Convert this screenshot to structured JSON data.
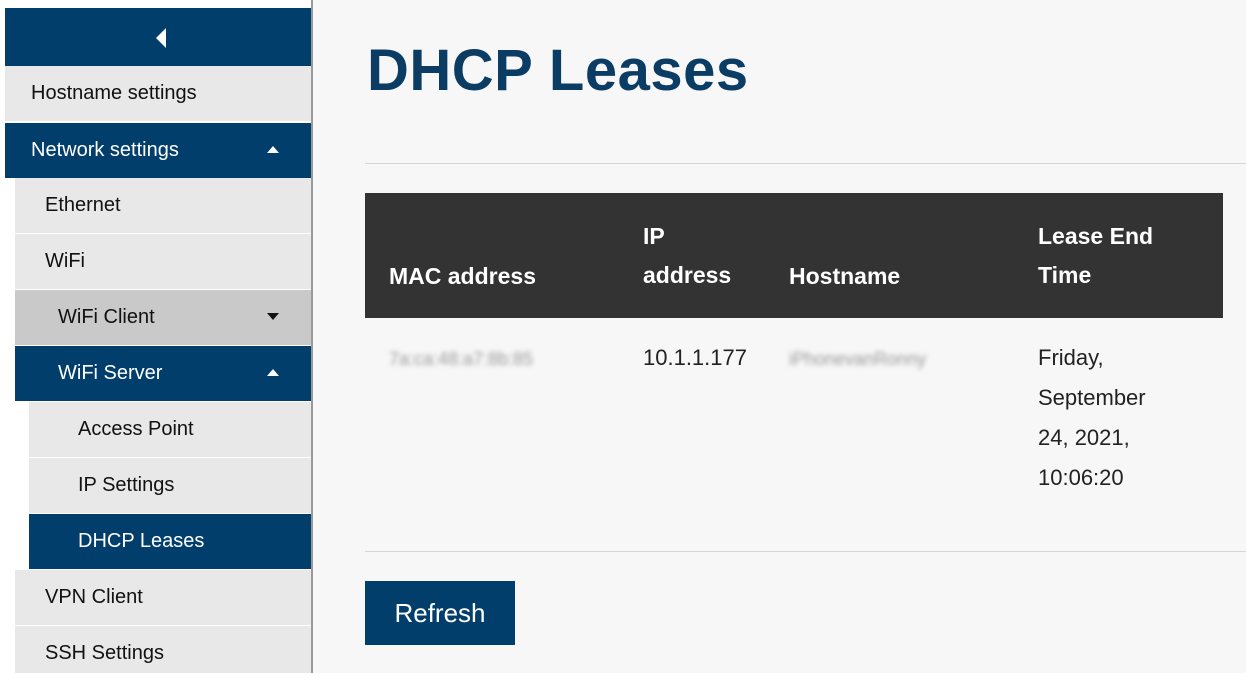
{
  "sidebar": {
    "collapse_icon": "chevron-left-icon",
    "items": [
      {
        "label": "Hostname settings"
      },
      {
        "label": "Network settings",
        "expanded": true
      },
      {
        "label": "Ethernet"
      },
      {
        "label": "WiFi"
      },
      {
        "label": "WiFi Client",
        "expanded": false
      },
      {
        "label": "WiFi Server",
        "expanded": true
      },
      {
        "label": "Access Point"
      },
      {
        "label": "IP Settings"
      },
      {
        "label": "DHCP Leases",
        "active": true
      },
      {
        "label": "VPN Client"
      },
      {
        "label": "SSH Settings"
      }
    ]
  },
  "main": {
    "title": "DHCP Leases",
    "table": {
      "headers": {
        "mac": "MAC address",
        "ip_line1": "IP",
        "ip_line2": "address",
        "hostname": "Hostname",
        "end_line1": "Lease End",
        "end_line2": "Time"
      },
      "rows": [
        {
          "mac": "7a:ca:48:a7:8b:85",
          "ip": "10.1.1.177",
          "hostname": "iPhonevanRonny",
          "end_line1": "Friday,",
          "end_line2": "September",
          "end_line3": "24, 2021,",
          "end_line4": "10:06:20"
        }
      ]
    },
    "refresh_label": "Refresh"
  },
  "colors": {
    "accent": "#023e6b",
    "title": "#0b3c63",
    "table_header": "#333333",
    "sidebar_bg": "#e8e8e8"
  }
}
